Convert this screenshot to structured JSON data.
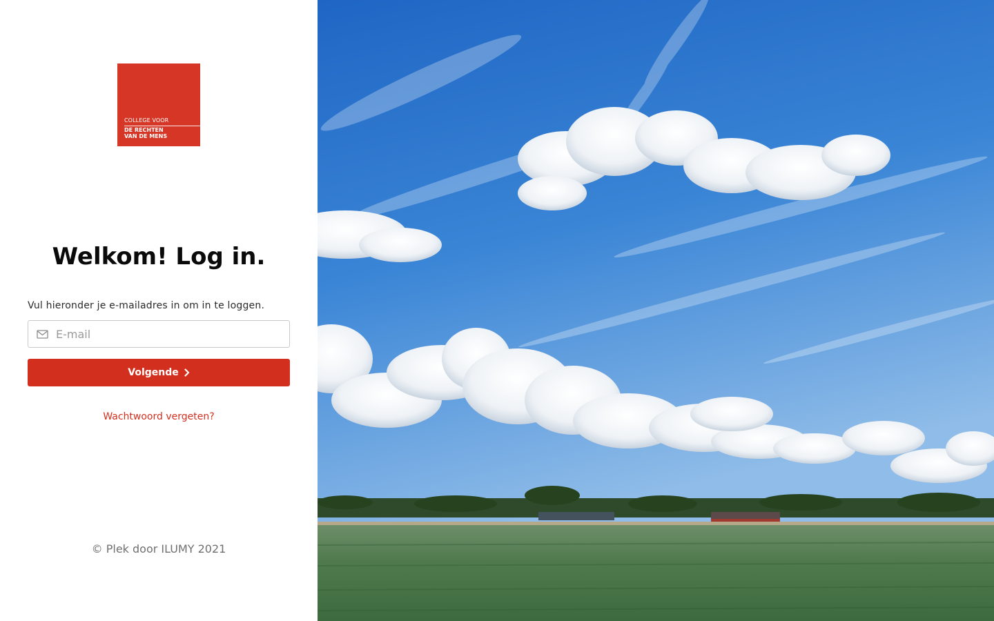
{
  "logo": {
    "line1": "COLLEGE VOOR",
    "line2": "DE RECHTEN",
    "line3": "VAN DE MENS",
    "color": "#d63625"
  },
  "login": {
    "title": "Welkom! Log in.",
    "instruction": "Vul hieronder je e-mailadres in om in te loggen.",
    "email_placeholder": "E-mail",
    "email_value": "",
    "next_button_label": "Volgende",
    "forgot_password_label": "Wachtwoord vergeten?"
  },
  "footer": {
    "copyright": "© Plek door ILUMY 2021"
  },
  "colors": {
    "accent": "#d32f1e",
    "sky": "#2f7fd0",
    "field": "#4c7a4a"
  },
  "icons": {
    "email": "mail-icon",
    "next": "chevron-right-icon"
  }
}
